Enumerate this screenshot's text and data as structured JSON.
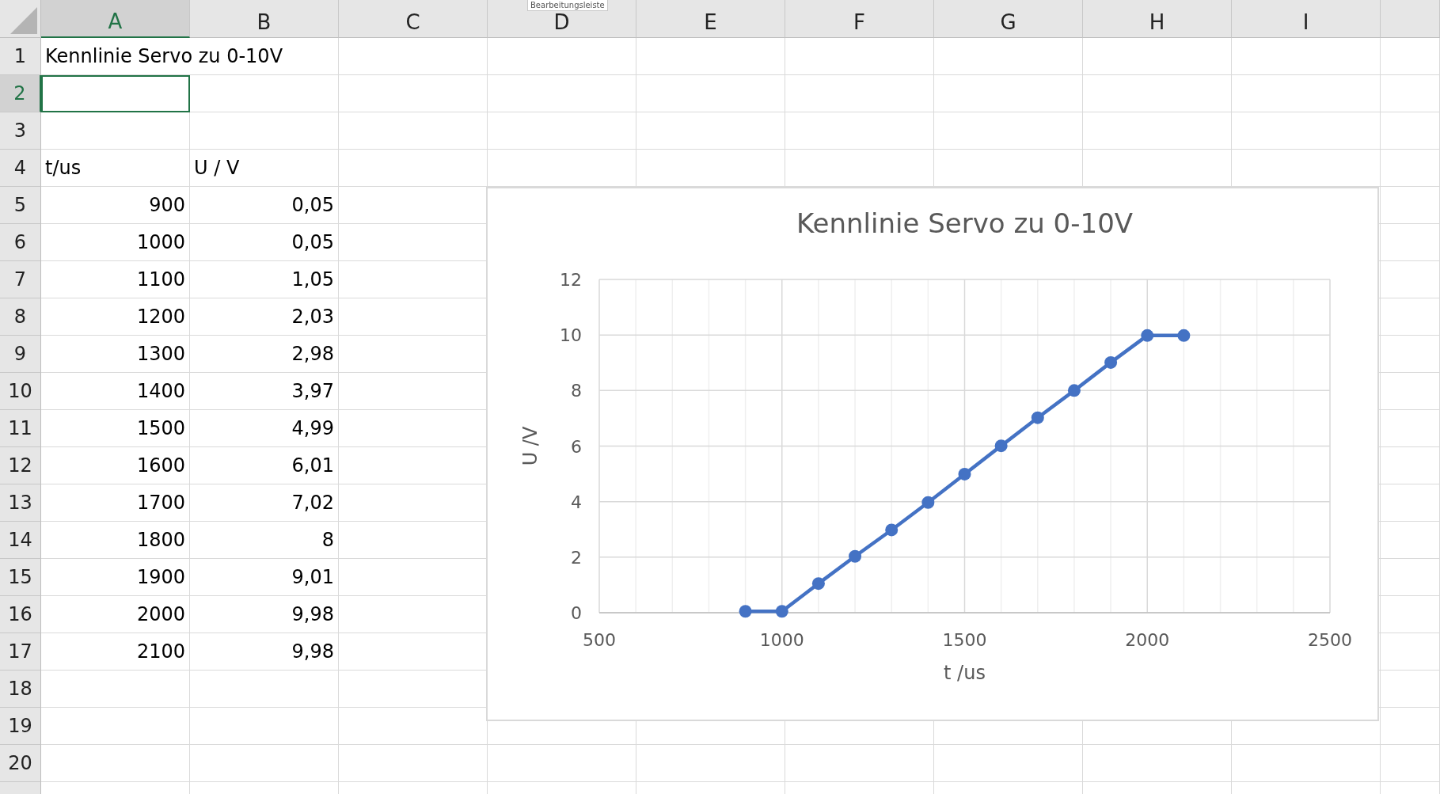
{
  "tooltip": {
    "text": "Bearbeitungsleiste"
  },
  "columns": [
    {
      "label": "A",
      "selected": true
    },
    {
      "label": "B",
      "selected": false
    },
    {
      "label": "C",
      "selected": false
    },
    {
      "label": "D",
      "selected": false
    },
    {
      "label": "E",
      "selected": false
    },
    {
      "label": "F",
      "selected": false
    },
    {
      "label": "G",
      "selected": false
    },
    {
      "label": "H",
      "selected": false
    },
    {
      "label": "I",
      "selected": false
    }
  ],
  "rows": [
    {
      "header": "1",
      "selected": false,
      "cells": [
        {
          "kind": "text",
          "text": "Kennlinie Servo zu 0-10V"
        }
      ]
    },
    {
      "header": "2",
      "selected": true,
      "cells": []
    },
    {
      "header": "3",
      "selected": false,
      "cells": []
    },
    {
      "header": "4",
      "selected": false,
      "cells": [
        {
          "kind": "text",
          "text": "t/us"
        },
        {
          "kind": "text",
          "text": "U / V"
        }
      ]
    },
    {
      "header": "5",
      "selected": false,
      "cells": [
        {
          "kind": "number",
          "text": "900"
        },
        {
          "kind": "number",
          "text": "0,05"
        }
      ]
    },
    {
      "header": "6",
      "selected": false,
      "cells": [
        {
          "kind": "number",
          "text": "1000"
        },
        {
          "kind": "number",
          "text": "0,05"
        }
      ]
    },
    {
      "header": "7",
      "selected": false,
      "cells": [
        {
          "kind": "number",
          "text": "1100"
        },
        {
          "kind": "number",
          "text": "1,05"
        }
      ]
    },
    {
      "header": "8",
      "selected": false,
      "cells": [
        {
          "kind": "number",
          "text": "1200"
        },
        {
          "kind": "number",
          "text": "2,03"
        }
      ]
    },
    {
      "header": "9",
      "selected": false,
      "cells": [
        {
          "kind": "number",
          "text": "1300"
        },
        {
          "kind": "number",
          "text": "2,98"
        }
      ]
    },
    {
      "header": "10",
      "selected": false,
      "cells": [
        {
          "kind": "number",
          "text": "1400"
        },
        {
          "kind": "number",
          "text": "3,97"
        }
      ]
    },
    {
      "header": "11",
      "selected": false,
      "cells": [
        {
          "kind": "number",
          "text": "1500"
        },
        {
          "kind": "number",
          "text": "4,99"
        }
      ]
    },
    {
      "header": "12",
      "selected": false,
      "cells": [
        {
          "kind": "number",
          "text": "1600"
        },
        {
          "kind": "number",
          "text": "6,01"
        }
      ]
    },
    {
      "header": "13",
      "selected": false,
      "cells": [
        {
          "kind": "number",
          "text": "1700"
        },
        {
          "kind": "number",
          "text": "7,02"
        }
      ]
    },
    {
      "header": "14",
      "selected": false,
      "cells": [
        {
          "kind": "number",
          "text": "1800"
        },
        {
          "kind": "number",
          "text": "8"
        }
      ]
    },
    {
      "header": "15",
      "selected": false,
      "cells": [
        {
          "kind": "number",
          "text": "1900"
        },
        {
          "kind": "number",
          "text": "9,01"
        }
      ]
    },
    {
      "header": "16",
      "selected": false,
      "cells": [
        {
          "kind": "number",
          "text": "2000"
        },
        {
          "kind": "number",
          "text": "9,98"
        }
      ]
    },
    {
      "header": "17",
      "selected": false,
      "cells": [
        {
          "kind": "number",
          "text": "2100"
        },
        {
          "kind": "number",
          "text": "9,98"
        }
      ]
    },
    {
      "header": "18",
      "selected": false,
      "cells": []
    },
    {
      "header": "19",
      "selected": false,
      "cells": []
    },
    {
      "header": "20",
      "selected": false,
      "cells": []
    }
  ],
  "chart": {
    "chart_data": {
      "type": "line",
      "grid": true,
      "title": "Kennlinie Servo zu 0-10V",
      "xlabel": "t /us",
      "ylabel": "U /V",
      "x": [
        900,
        1000,
        1100,
        1200,
        1300,
        1400,
        1500,
        1600,
        1700,
        1800,
        1900,
        2000,
        2100
      ],
      "series": [
        {
          "color": "#4472c4",
          "marker": "circle",
          "values": [
            0.05,
            0.05,
            1.05,
            2.03,
            2.98,
            3.97,
            4.99,
            6.01,
            7.02,
            8,
            9.01,
            9.98,
            9.98
          ]
        }
      ],
      "xlim": [
        500,
        2500
      ],
      "ylim": [
        0,
        12
      ],
      "xticks": [
        500,
        1000,
        1500,
        2000,
        2500
      ],
      "yticks": [
        0,
        2,
        4,
        6,
        8,
        10,
        12
      ]
    }
  }
}
